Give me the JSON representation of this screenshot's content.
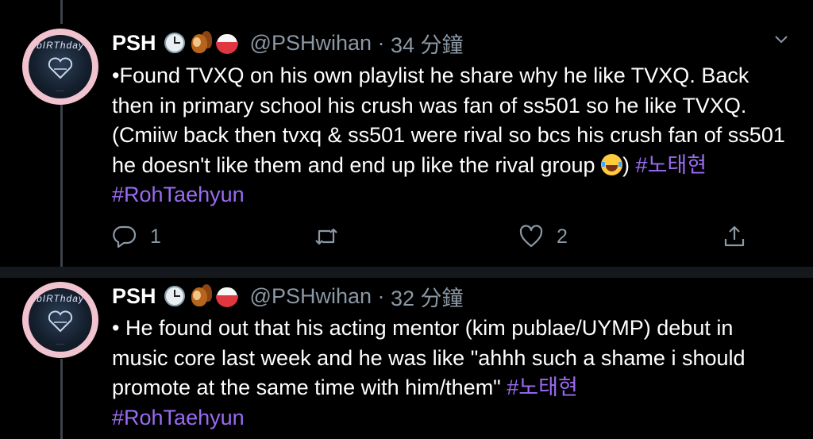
{
  "tweets": [
    {
      "name": "PSH",
      "handle": "@PSHwihan",
      "separator": " · ",
      "time": "34 分鐘",
      "avatar_text": "bIRThday",
      "emojis": [
        "clock-emoji",
        "chipmunk-emoji",
        "rice-bowl-emoji"
      ],
      "body": {
        "text": "•Found TVXQ on his own playlist he share why he like TVXQ. Back then in primary school his crush was fan of ss501 so he like TVXQ.(Cmiiw back then tvxq & ss501 were rival so bcs his crush fan of ss501 he doesn't like them and end up like the rival group ",
        "after_emoji": ") ",
        "hashtags": [
          "#노태현",
          "#RohTaehyun"
        ]
      },
      "replies": "1",
      "likes": "2"
    },
    {
      "name": "PSH",
      "handle": "@PSHwihan",
      "separator": " · ",
      "time": "32 分鐘",
      "avatar_text": "bIRThday",
      "emojis": [
        "clock-emoji",
        "chipmunk-emoji",
        "rice-bowl-emoji"
      ],
      "body": {
        "text": "• He found out that his acting mentor (kim publae/UYMP) debut in music core last week and he was like \"ahhh such a shame i should promote at the same time with him/them\" ",
        "hashtags": [
          "#노태현",
          "#RohTaehyun"
        ]
      }
    }
  ],
  "colors": {
    "background": "#000000",
    "divider": "#15181c",
    "secondary_text": "#8b98a5",
    "hashtag": "#9a6bf2",
    "thread_line": "#3d4349"
  }
}
